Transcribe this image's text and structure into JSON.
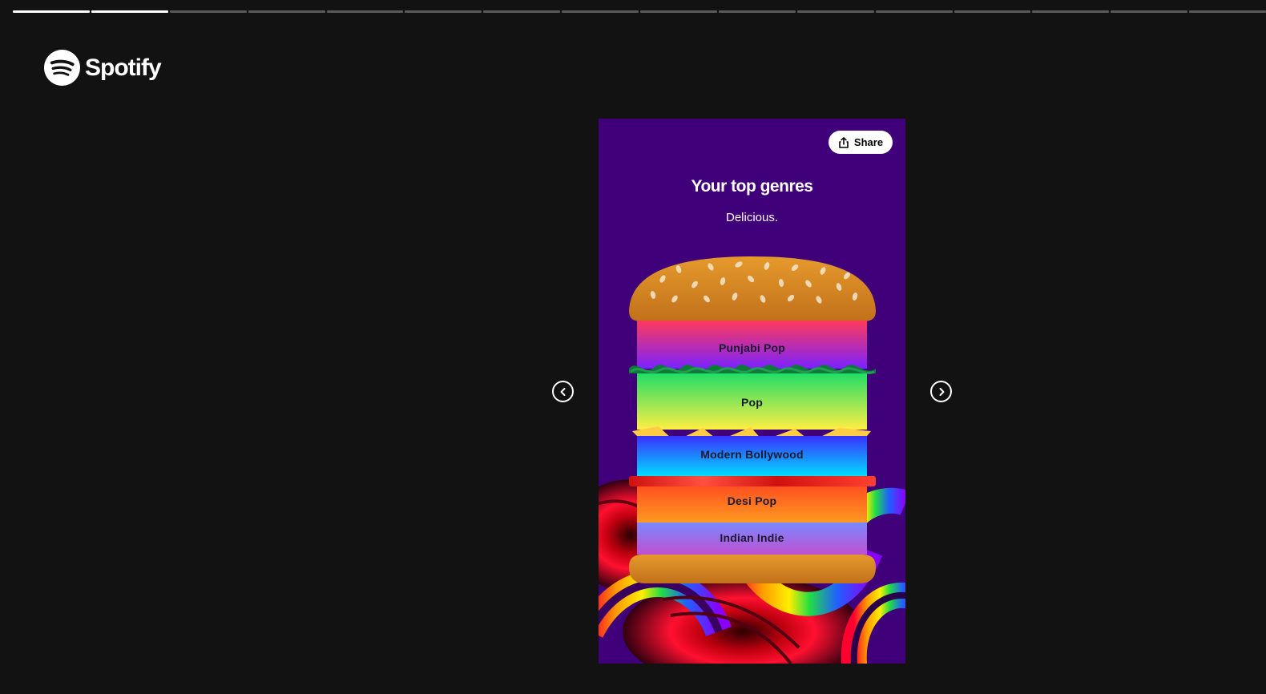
{
  "progress": {
    "segments_total": 16,
    "segments_completed": 2
  },
  "brand": {
    "name": "Spotify"
  },
  "story": {
    "share_label": "Share",
    "title": "Your top genres",
    "subtitle": "Delicious.",
    "genres": [
      {
        "rank": 1,
        "name": "Punjabi Pop"
      },
      {
        "rank": 2,
        "name": "Pop"
      },
      {
        "rank": 3,
        "name": "Modern Bollywood"
      },
      {
        "rank": 4,
        "name": "Desi Pop"
      },
      {
        "rank": 5,
        "name": "Indian Indie"
      }
    ]
  },
  "navigation": {
    "prev_icon": "chevron-left-icon",
    "next_icon": "chevron-right-icon"
  },
  "colors": {
    "page_background": "#121212",
    "card_background": "#40007a",
    "progress_done": "#ffffff",
    "progress_pending": "#5a5a5a"
  }
}
